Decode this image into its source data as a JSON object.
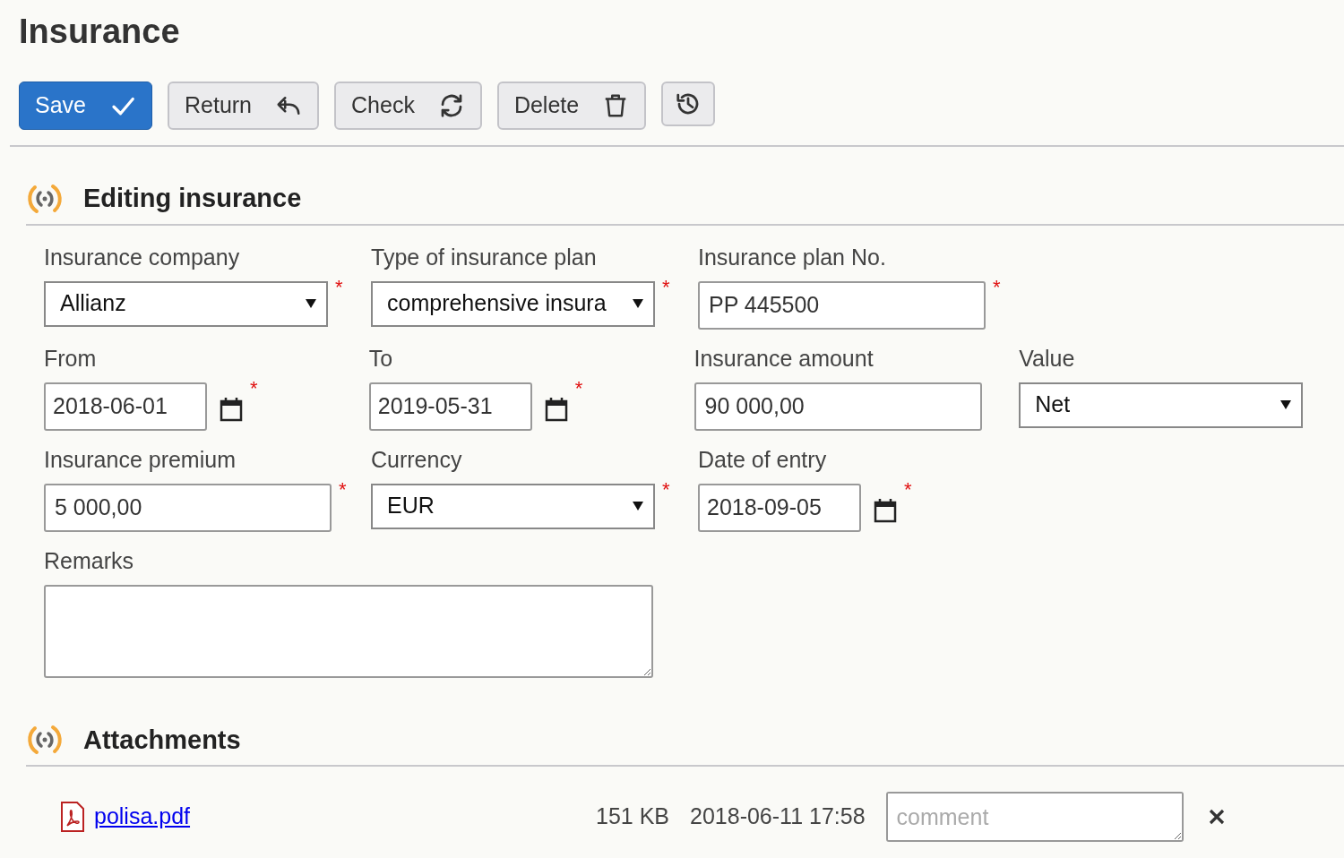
{
  "page": {
    "title": "Insurance"
  },
  "toolbar": [
    {
      "kind": "save",
      "label": "Save",
      "primary": true
    },
    {
      "kind": "return",
      "label": "Return",
      "primary": false
    },
    {
      "kind": "check",
      "label": "Check",
      "primary": false
    },
    {
      "kind": "delete",
      "label": "Delete",
      "primary": false
    },
    {
      "kind": "history",
      "primary": false
    }
  ],
  "form": {
    "title": "Editing insurance",
    "rows": [
      [
        {
          "kind": "select",
          "label": "Insurance company",
          "value": "Allianz",
          "required_mark": "*"
        },
        {
          "kind": "select",
          "label": "Type of insurance plan",
          "value": "comprehensive insura",
          "required_mark": "*"
        },
        {
          "kind": "text",
          "label": "Insurance plan No.",
          "value": "PP 445500",
          "required_mark": "*"
        }
      ],
      [
        {
          "kind": "date",
          "label": "From",
          "value": "2018-06-01",
          "required_mark": "*"
        },
        {
          "kind": "date",
          "label": "To",
          "value": "2019-05-31",
          "required_mark": "*"
        },
        {
          "kind": "text",
          "label": "Insurance amount",
          "value": "90 000,00"
        },
        {
          "kind": "select",
          "label": "Value",
          "value": "Net"
        }
      ],
      [
        {
          "kind": "text",
          "label": "Insurance premium",
          "value": "5 000,00",
          "required_mark": "*"
        },
        {
          "kind": "select",
          "label": "Currency",
          "value": "EUR",
          "required_mark": "*"
        },
        {
          "kind": "date",
          "label": "Date of entry",
          "value": "2018-09-05",
          "required_mark": "*"
        }
      ],
      [
        {
          "kind": "textarea",
          "label": "Remarks"
        }
      ]
    ]
  },
  "attachments": {
    "title": "Attachments",
    "files": [
      {
        "name": "polisa.pdf",
        "size": "151 KB",
        "date": "2018-06-11 17:58",
        "comment": {
          "placeholder": "comment"
        }
      }
    ]
  }
}
